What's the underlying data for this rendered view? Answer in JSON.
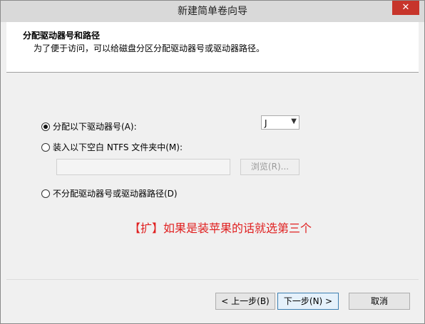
{
  "window": {
    "title": "新建简单卷向导",
    "close_glyph": "✕"
  },
  "header": {
    "title": "分配驱动器号和路径",
    "subtitle": "为了便于访问，可以给磁盘分区分配驱动器号或驱动器路径。"
  },
  "options": {
    "assign_letter_label": "分配以下驱动器号(A):",
    "mount_folder_label": "装入以下空白 NTFS 文件夹中(M):",
    "no_assign_label": "不分配驱动器号或驱动器路径(D)",
    "selected": "assign_letter"
  },
  "drive_letter": {
    "value": "J"
  },
  "mount_path": {
    "value": ""
  },
  "browse_label": "浏览(R)...",
  "annotation": "【扩】如果是装苹果的话就选第三个",
  "buttons": {
    "back": "< 上一步(B)",
    "next": "下一步(N) >",
    "cancel": "取消"
  },
  "icons": {
    "combo_arrow": "chevron-down-icon",
    "close": "close-icon"
  },
  "colors": {
    "annotation": "#e02020",
    "close_button": "#c7352b"
  }
}
